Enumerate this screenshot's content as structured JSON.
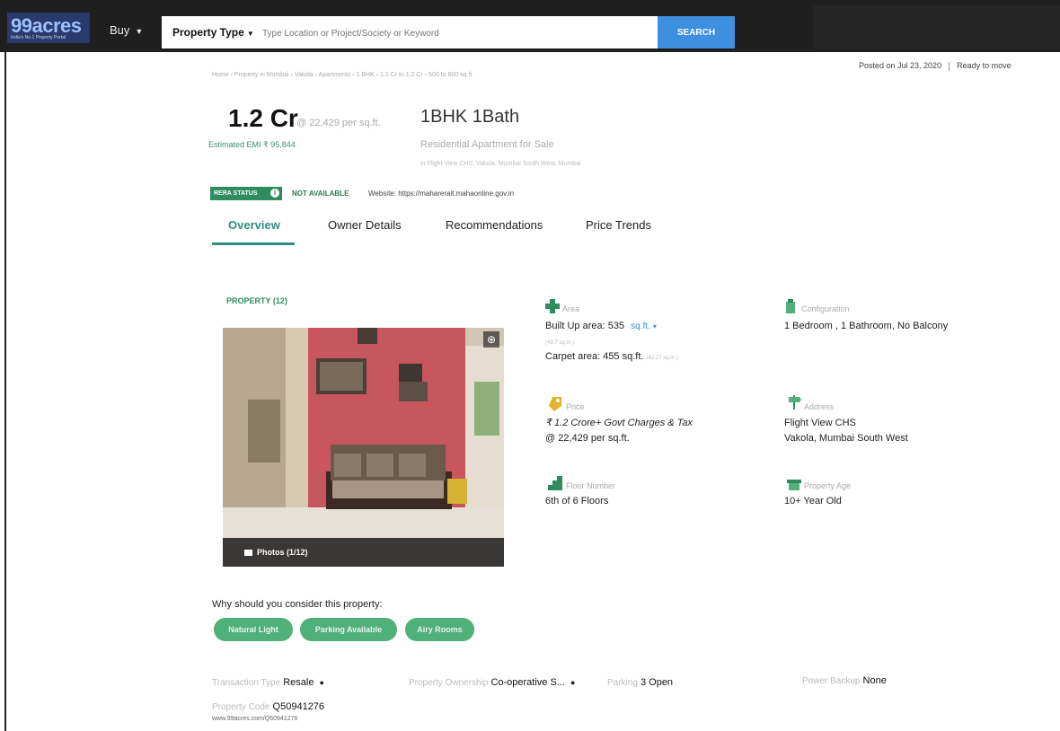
{
  "header": {
    "logo_text": "99acres",
    "logo_tagline": "India's No.1 Property Portal",
    "buy_label": "Buy",
    "property_type_label": "Property Type",
    "search_placeholder": "Type Location or Project/Society or Keyword",
    "search_button": "SEARCH"
  },
  "breadcrumb": "Home › Property in Mumbai › Vakola › Apartments › 1 BHK › 1.1 Cr to 1.2 Cr › 500 to 600 sq.ft",
  "posted_on": "Posted on Jul 23, 2020",
  "possession": "Ready to move",
  "price": "1.2 Cr",
  "price_per_sqft": "@ 22,429 per sq.ft.",
  "emi": "Estimated EMI ₹ 95,844",
  "title": "1BHK 1Bath",
  "property_type_text": "Residential Apartment for Sale",
  "location_line": "in Flight View CHS, Vakola, Mumbai South West, Mumbai",
  "rera": {
    "badge": "RERA STATUS",
    "status": "NOT AVAILABLE",
    "website": "Website: https://maharerait.mahaonline.gov.in"
  },
  "tabs": [
    {
      "label": "Overview"
    },
    {
      "label": "Owner Details"
    },
    {
      "label": "Recommendations"
    },
    {
      "label": "Price Trends"
    }
  ],
  "property_label": "PROPERTY (12)",
  "photo_count": "Photos (1/12)",
  "details": {
    "area_label": "Area",
    "built_up": "Built Up area: 535",
    "unit": "sq.ft.",
    "built_up_sqm": "(49.7 sq.m.)",
    "carpet": "Carpet area: 455 sq.ft.",
    "carpet_sqm": "(42.27 sq.m.)",
    "config_label": "Configuration",
    "config_value": "1 Bedroom , 1 Bathroom, No Balcony",
    "price_label": "Price",
    "price_line1": "₹ 1.2 Crore+ Govt Charges & Tax",
    "price_line2": "@ 22,429 per sq.ft.",
    "address_label": "Address",
    "address_line1": "Flight View CHS",
    "address_line2": "Vakola, Mumbai South West",
    "floor_label": "Floor Number",
    "floor_value": "6th of 6 Floors",
    "age_label": "Property Age",
    "age_value": "10+ Year Old"
  },
  "why_heading": "Why should you consider this property:",
  "highlights": [
    "Natural Light",
    "Parking Available",
    "Airy Rooms"
  ],
  "facts": {
    "transaction_label": "Transaction Type",
    "transaction_value": "Resale",
    "ownership_label": "Property Ownership",
    "ownership_value": "Co-operative S...",
    "parking_label": "Parking",
    "parking_value": "3 Open",
    "power_label": "Power Backup",
    "power_value": "None",
    "code_label": "Property Code",
    "code_value": "Q50941276",
    "code_url": "www.99acres.com/Q50941276"
  },
  "colors": {
    "accent": "#2f8f7f",
    "green": "#2e8c5e",
    "search_button": "#3f8fe0"
  },
  "icons": [
    "chevron-down-icon",
    "info-icon",
    "zoom-icon",
    "camera-icon",
    "area-icon",
    "configuration-icon",
    "price-tag-icon",
    "address-signpost-icon",
    "floor-icon",
    "property-age-icon"
  ]
}
